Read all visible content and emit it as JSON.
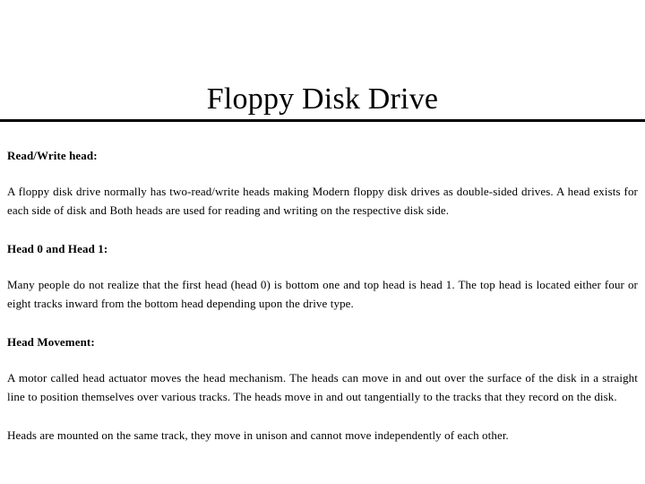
{
  "document": {
    "title": "Floppy Disk Drive",
    "title_underlined": true,
    "background_color": "#ffffff",
    "text_color": "#000000"
  },
  "sections": [
    {
      "heading": "Read/Write head:",
      "body": "A floppy disk drive normally has two-read/write heads making Modern floppy disk drives as double-sided drives. A head exists for each side of disk and Both heads are used for reading and writing on the respective disk side."
    },
    {
      "heading": "Head 0 and Head 1:",
      "body": "Many people do not realize that the first head (head 0) is bottom one and top head is head 1. The top head is located either four or eight tracks inward from the bottom head depending upon the drive type."
    },
    {
      "heading": "Head Movement:",
      "body": "A motor called head actuator moves the head mechanism. The heads can move in and out over the surface of the disk in a straight line to position themselves over various tracks. The heads move in and out tangentially to the tracks that they record on the disk."
    }
  ],
  "closing_paragraph": "Heads are mounted on the same track, they move in unison and cannot move independently of each other."
}
